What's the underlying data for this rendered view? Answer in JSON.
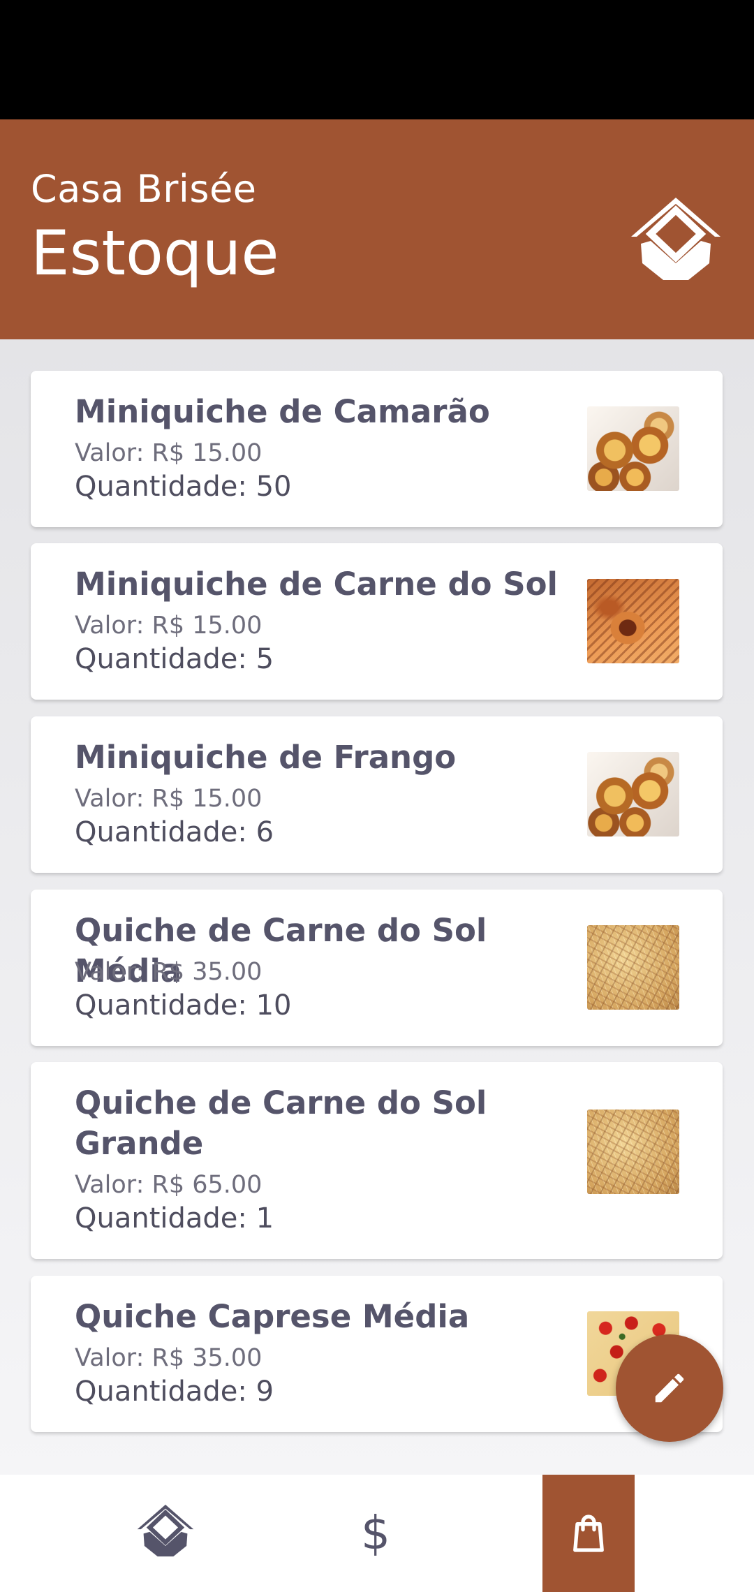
{
  "header": {
    "subtitle": "Casa Brisée",
    "title": "Estoque",
    "logo_icon": "casa-brisee-logo-icon"
  },
  "products": [
    {
      "name": "Miniquiche de Camarão",
      "price": "Valor: R$ 15.00",
      "quantity": "Quantidade: 50",
      "image": "tartlets"
    },
    {
      "name": "Miniquiche de Carne do Sol",
      "price": "Valor: R$ 15.00",
      "quantity": "Quantidade: 5",
      "image": "carne-do-sol"
    },
    {
      "name": "Miniquiche de Frango",
      "price": "Valor: R$ 15.00",
      "quantity": "Quantidade: 6",
      "image": "tartlets"
    },
    {
      "name": "Quiche de Carne do Sol Média",
      "price": "Valor: R$ 35.00",
      "quantity": "Quantidade: 10",
      "image": "quiche-grain"
    },
    {
      "name": "Quiche de Carne do Sol Grande",
      "price": "Valor: R$ 65.00",
      "quantity": "Quantidade: 1",
      "image": "quiche-grain"
    },
    {
      "name": "Quiche Caprese Média",
      "price": "Valor: R$ 35.00",
      "quantity": "Quantidade: 9",
      "image": "caprese"
    }
  ],
  "fab": {
    "icon": "pencil-edit-icon"
  },
  "bottom_nav": {
    "items": [
      {
        "icon": "home-logo-icon",
        "active": false
      },
      {
        "icon": "dollar-icon",
        "label": "$",
        "active": false
      },
      {
        "icon": "shopping-bag-icon",
        "active": true
      }
    ]
  },
  "colors": {
    "brand": "#a05432",
    "text_primary": "#55546a",
    "text_secondary": "#6e6d7c"
  }
}
